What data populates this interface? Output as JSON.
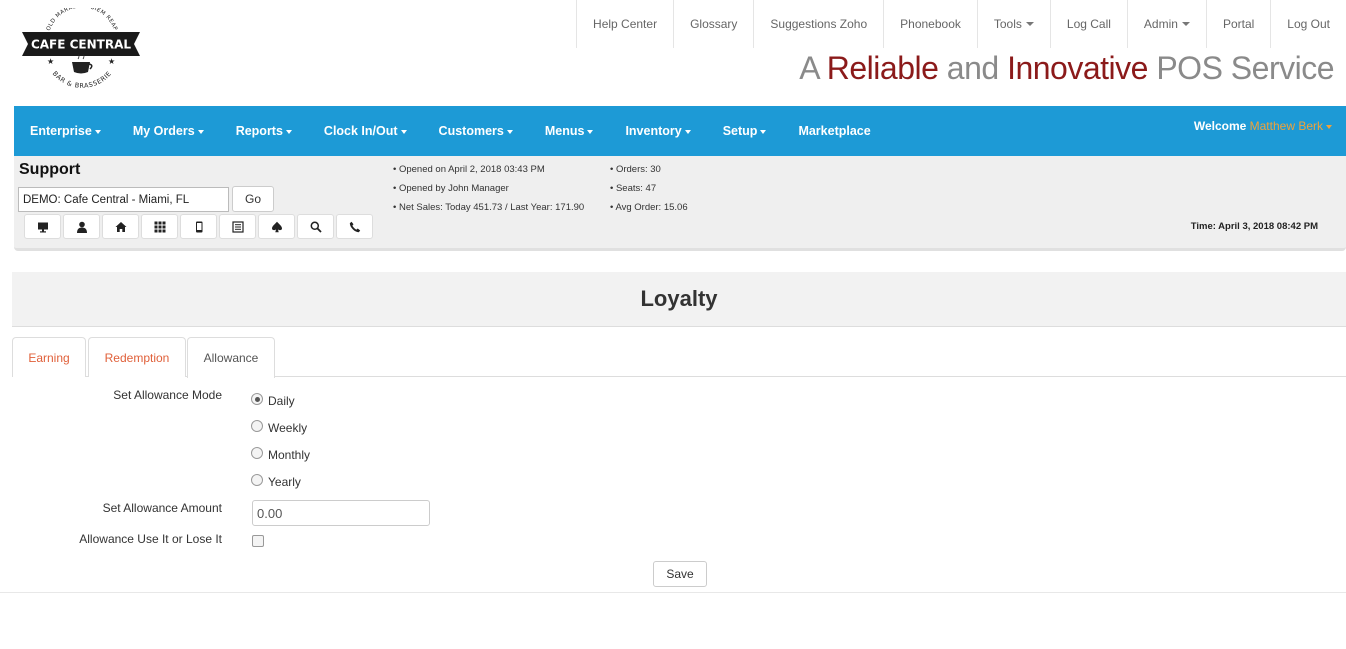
{
  "brand": {
    "logo_top_text": "OLD MARKET ★ SIEM REAP",
    "logo_name": "CAFE CENTRAL",
    "logo_bottom_text": "BAR & BRASSERIE",
    "tagline": {
      "p1": "A ",
      "p2": "Reliable",
      "p3": " and ",
      "p4": "Innovative",
      "p5": " POS Service"
    }
  },
  "top_links": [
    {
      "label": "Help Center"
    },
    {
      "label": "Glossary"
    },
    {
      "label": "Suggestions Zoho"
    },
    {
      "label": "Phonebook"
    },
    {
      "label": "Tools"
    },
    {
      "label": "Log Call"
    },
    {
      "label": "Admin"
    },
    {
      "label": "Portal"
    },
    {
      "label": "Log Out"
    }
  ],
  "nav": {
    "items": [
      {
        "label": "Enterprise"
      },
      {
        "label": "My Orders"
      },
      {
        "label": "Reports"
      },
      {
        "label": "Clock In/Out"
      },
      {
        "label": "Customers"
      },
      {
        "label": "Menus"
      },
      {
        "label": "Inventory"
      },
      {
        "label": "Setup"
      },
      {
        "label": "Marketplace"
      }
    ],
    "welcome_label": "Welcome ",
    "user_name": "Matthew Berk"
  },
  "support": {
    "title": "Support",
    "store_value": "DEMO: Cafe Central - Miami, FL",
    "go_label": "Go",
    "icons": [
      "monitor-icon",
      "user-icon",
      "home-icon",
      "grid-icon",
      "mobile-icon",
      "list-icon",
      "spade-icon",
      "search-icon",
      "phone-icon"
    ],
    "stats_left": [
      "• Opened on April 2, 2018 03:43 PM",
      "• Opened by John Manager",
      "• Net Sales: Today 451.73 / Last Year: 171.90"
    ],
    "stats_right": [
      "• Orders: 30",
      "• Seats: 47",
      "• Avg Order: 15.06"
    ],
    "time": "Time: April 3, 2018 08:42 PM"
  },
  "page": {
    "title": "Loyalty",
    "tabs": [
      {
        "label": "Earning"
      },
      {
        "label": "Redemption"
      },
      {
        "label": "Allowance"
      }
    ],
    "active_tab": "Allowance"
  },
  "form": {
    "mode_label": "Set Allowance Mode",
    "mode_options": [
      "Daily",
      "Weekly",
      "Monthly",
      "Yearly"
    ],
    "mode_selected": "Daily",
    "amount_label": "Set Allowance Amount",
    "amount_value": "0.00",
    "use_it_label": "Allowance Use It or Lose It",
    "use_it_checked": false,
    "save_label": "Save"
  },
  "colors": {
    "nav_bg": "#1d9ad6",
    "accent_red": "#8b1a1a",
    "tab_link": "#e0603a",
    "user_name": "#f0a23a"
  }
}
